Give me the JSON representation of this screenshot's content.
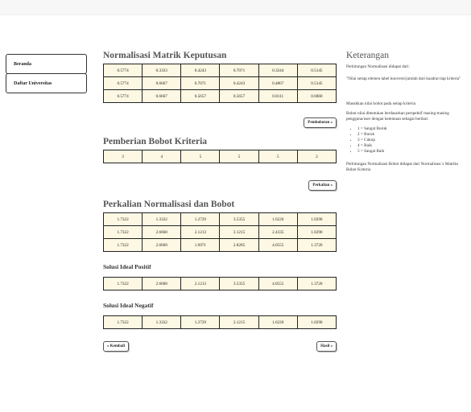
{
  "sidebar": {
    "items": [
      {
        "label": "Beranda"
      },
      {
        "label": "Daftar Universitas"
      }
    ]
  },
  "normalisasi": {
    "title": "Normalisasi Matrik Keputusan",
    "rows": [
      [
        "0.5774",
        "0.3333",
        "0.4243",
        "0.7071",
        "0.3244",
        "0.5145"
      ],
      [
        "0.5774",
        "0.6667",
        "0.7071",
        "0.4243",
        "0.4867",
        "0.5145"
      ],
      [
        "0.5774",
        "0.6667",
        "0.5657",
        "0.5657",
        "0.8111",
        "0.6860"
      ]
    ],
    "button": "Pembobotan »"
  },
  "bobot": {
    "title": "Pemberian Bobot Kriteria",
    "values": [
      "3",
      "4",
      "5",
      "5",
      "5",
      "2"
    ],
    "button": "Perkalian »"
  },
  "perkalian": {
    "title": "Perkalian Normalisasi dan Bobot",
    "rows": [
      [
        "1.7322",
        "1.3332",
        "1.2729",
        "3.5355",
        "1.6220",
        "1.0290"
      ],
      [
        "1.7322",
        "2.6668",
        "2.1213",
        "2.1215",
        "2.4335",
        "1.0290"
      ],
      [
        "1.7322",
        "2.6668",
        "1.6971",
        "2.8285",
        "4.0555",
        "1.3720"
      ]
    ]
  },
  "ideal_positif": {
    "title": "Solusi Ideal Positif",
    "values": [
      "1.7322",
      "2.6668",
      "2.1213",
      "3.5355",
      "4.0555",
      "1.3720"
    ]
  },
  "ideal_negatif": {
    "title": "Solusi Ideal Negatif",
    "values": [
      "1.7322",
      "1.3332",
      "1.2729",
      "2.1215",
      "1.6220",
      "1.0290"
    ]
  },
  "nav": {
    "back": "« Kembali",
    "next": "Hasil »"
  },
  "keterangan": {
    "title": "Keterangan",
    "p1": "Perhitungan Normalisasi didapat dari:",
    "p2": "\"Nilai setiap elemen tabel konversi/jumlah dari kuadrat tiap kriteria\"",
    "p3": "Masukkan nilai bobot pada setiap kriteria",
    "p4": "Bobot nilai ditentukan berdasarkan perspektif masing-masing pengguna/user dengan ketentuan sebagai berikut:",
    "list": [
      "1 = Sangat Buruk",
      "2 = Buruk",
      "3 = Cukup",
      "4 = Baik",
      "5 = Sangat Baik"
    ],
    "p5": "Perhitungan Normalisasi Bobot didapat dari Normalisasi x Matriks Bobot Kriteria"
  }
}
